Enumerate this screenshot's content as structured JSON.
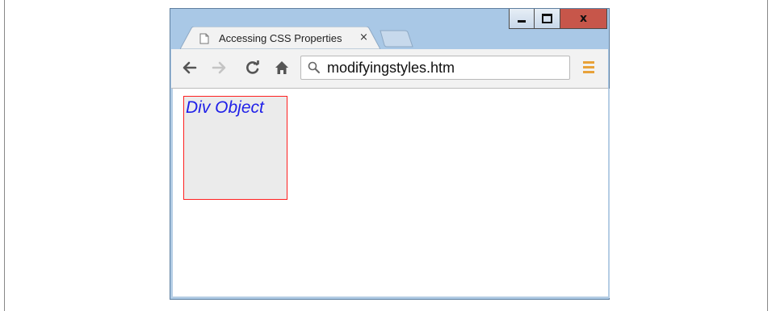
{
  "window": {
    "controls": {
      "minimize": "minimize",
      "maximize": "maximize",
      "close_label": "x"
    }
  },
  "tab": {
    "title": "Accessing CSS Properties",
    "close_label": "×",
    "icon": "page-icon"
  },
  "toolbar": {
    "back_icon": "back-arrow-icon",
    "forward_icon": "forward-arrow-icon",
    "reload_icon": "reload-icon",
    "home_icon": "home-icon",
    "address": "modifyingstyles.htm",
    "menu_icon": "hamburger-menu-icon"
  },
  "page": {
    "div_text": "Div Object"
  },
  "colors": {
    "frame": "#a9c8e6",
    "close_button": "#c7564a",
    "div_border": "#ff2020",
    "div_background": "#ebebeb",
    "div_text": "#2020e8",
    "menu_icon": "#e8a23a"
  }
}
